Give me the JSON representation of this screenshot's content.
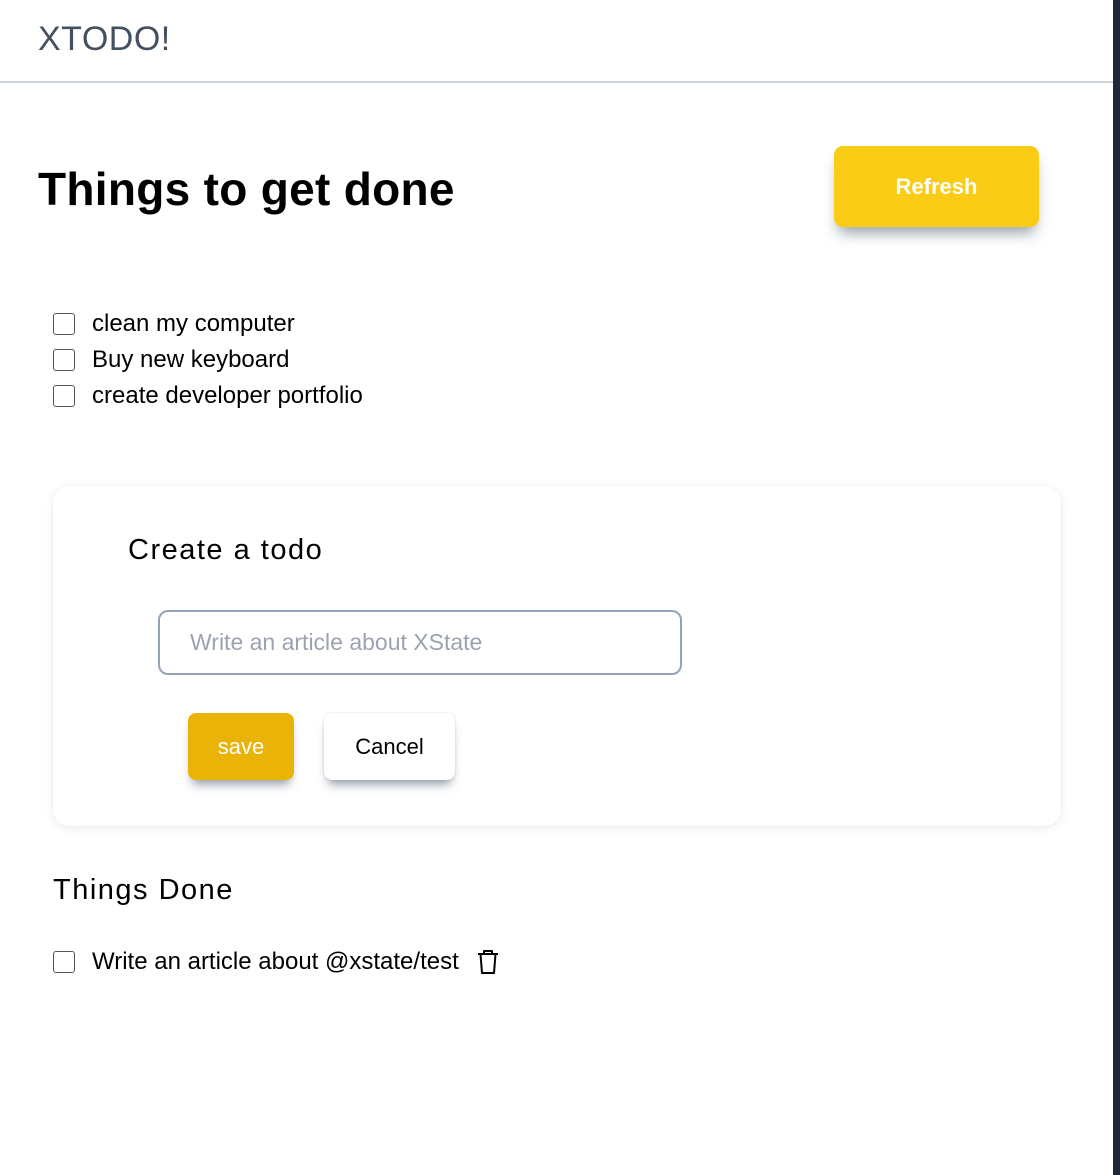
{
  "app": {
    "brand": "XTODO!"
  },
  "header": {
    "title": "Things to get done",
    "refresh_label": "Refresh"
  },
  "todos": [
    {
      "text": "clean my computer",
      "checked": false
    },
    {
      "text": "Buy new keyboard",
      "checked": false
    },
    {
      "text": "create developer portfolio",
      "checked": false
    }
  ],
  "create_form": {
    "title": "Create a todo",
    "input_value": "",
    "input_placeholder": "Write an article about XState",
    "save_label": "save",
    "cancel_label": "Cancel"
  },
  "done_section": {
    "title": "Things Done",
    "items": [
      {
        "text": "Write an article about @xstate/test",
        "checked": false,
        "icon": "trash-icon"
      }
    ]
  },
  "colors": {
    "refresh_button": "#facc15",
    "save_button": "#eab308",
    "input_border": "#94a3b8",
    "brand_text": "#44505f"
  }
}
